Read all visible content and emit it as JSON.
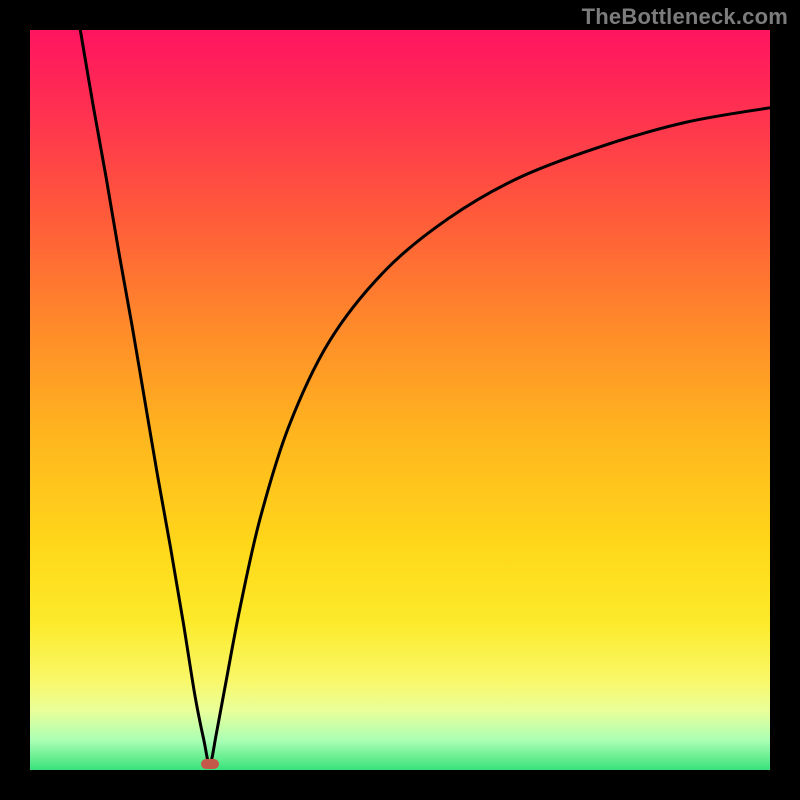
{
  "watermark": "TheBottleneck.com",
  "marker": {
    "color": "#c4594a",
    "x_pct": 24.3,
    "y_pct": 99.2
  },
  "chart_data": {
    "type": "line",
    "title": "",
    "xlabel": "",
    "ylabel": "",
    "xlim": [
      0,
      100
    ],
    "ylim": [
      0,
      100
    ],
    "grid": false,
    "legend": false,
    "series": [
      {
        "name": "left-branch",
        "x": [
          6.8,
          8.5,
          10.3,
          12.0,
          13.8,
          15.5,
          17.2,
          19.0,
          20.7,
          22.3,
          23.5,
          24.3
        ],
        "y": [
          100.0,
          90.0,
          80.0,
          70.0,
          60.0,
          50.0,
          40.0,
          30.0,
          20.0,
          10.0,
          4.0,
          0.8
        ]
      },
      {
        "name": "right-branch",
        "x": [
          24.3,
          25.2,
          26.5,
          28.4,
          31.1,
          35.0,
          40.5,
          48.0,
          56.5,
          66.0,
          77.0,
          88.5,
          100.0
        ],
        "y": [
          0.8,
          5.0,
          12.0,
          22.0,
          34.0,
          46.5,
          58.0,
          67.5,
          74.5,
          80.0,
          84.2,
          87.5,
          89.5
        ]
      }
    ],
    "markers": [
      {
        "name": "minimum",
        "x": 24.3,
        "y": 0.8,
        "color": "#c4594a"
      }
    ],
    "background_gradient": {
      "orientation": "vertical",
      "stops": [
        {
          "pos": 0.0,
          "color": "#ff1460"
        },
        {
          "pos": 0.1,
          "color": "#ff2e52"
        },
        {
          "pos": 0.25,
          "color": "#ff5a3a"
        },
        {
          "pos": 0.4,
          "color": "#ff8a2a"
        },
        {
          "pos": 0.55,
          "color": "#ffb61e"
        },
        {
          "pos": 0.7,
          "color": "#ffd81a"
        },
        {
          "pos": 0.8,
          "color": "#fcea2a"
        },
        {
          "pos": 0.88,
          "color": "#f9f86a"
        },
        {
          "pos": 0.92,
          "color": "#e9ff9a"
        },
        {
          "pos": 0.96,
          "color": "#aaffb4"
        },
        {
          "pos": 1.0,
          "color": "#39e27a"
        }
      ]
    }
  }
}
